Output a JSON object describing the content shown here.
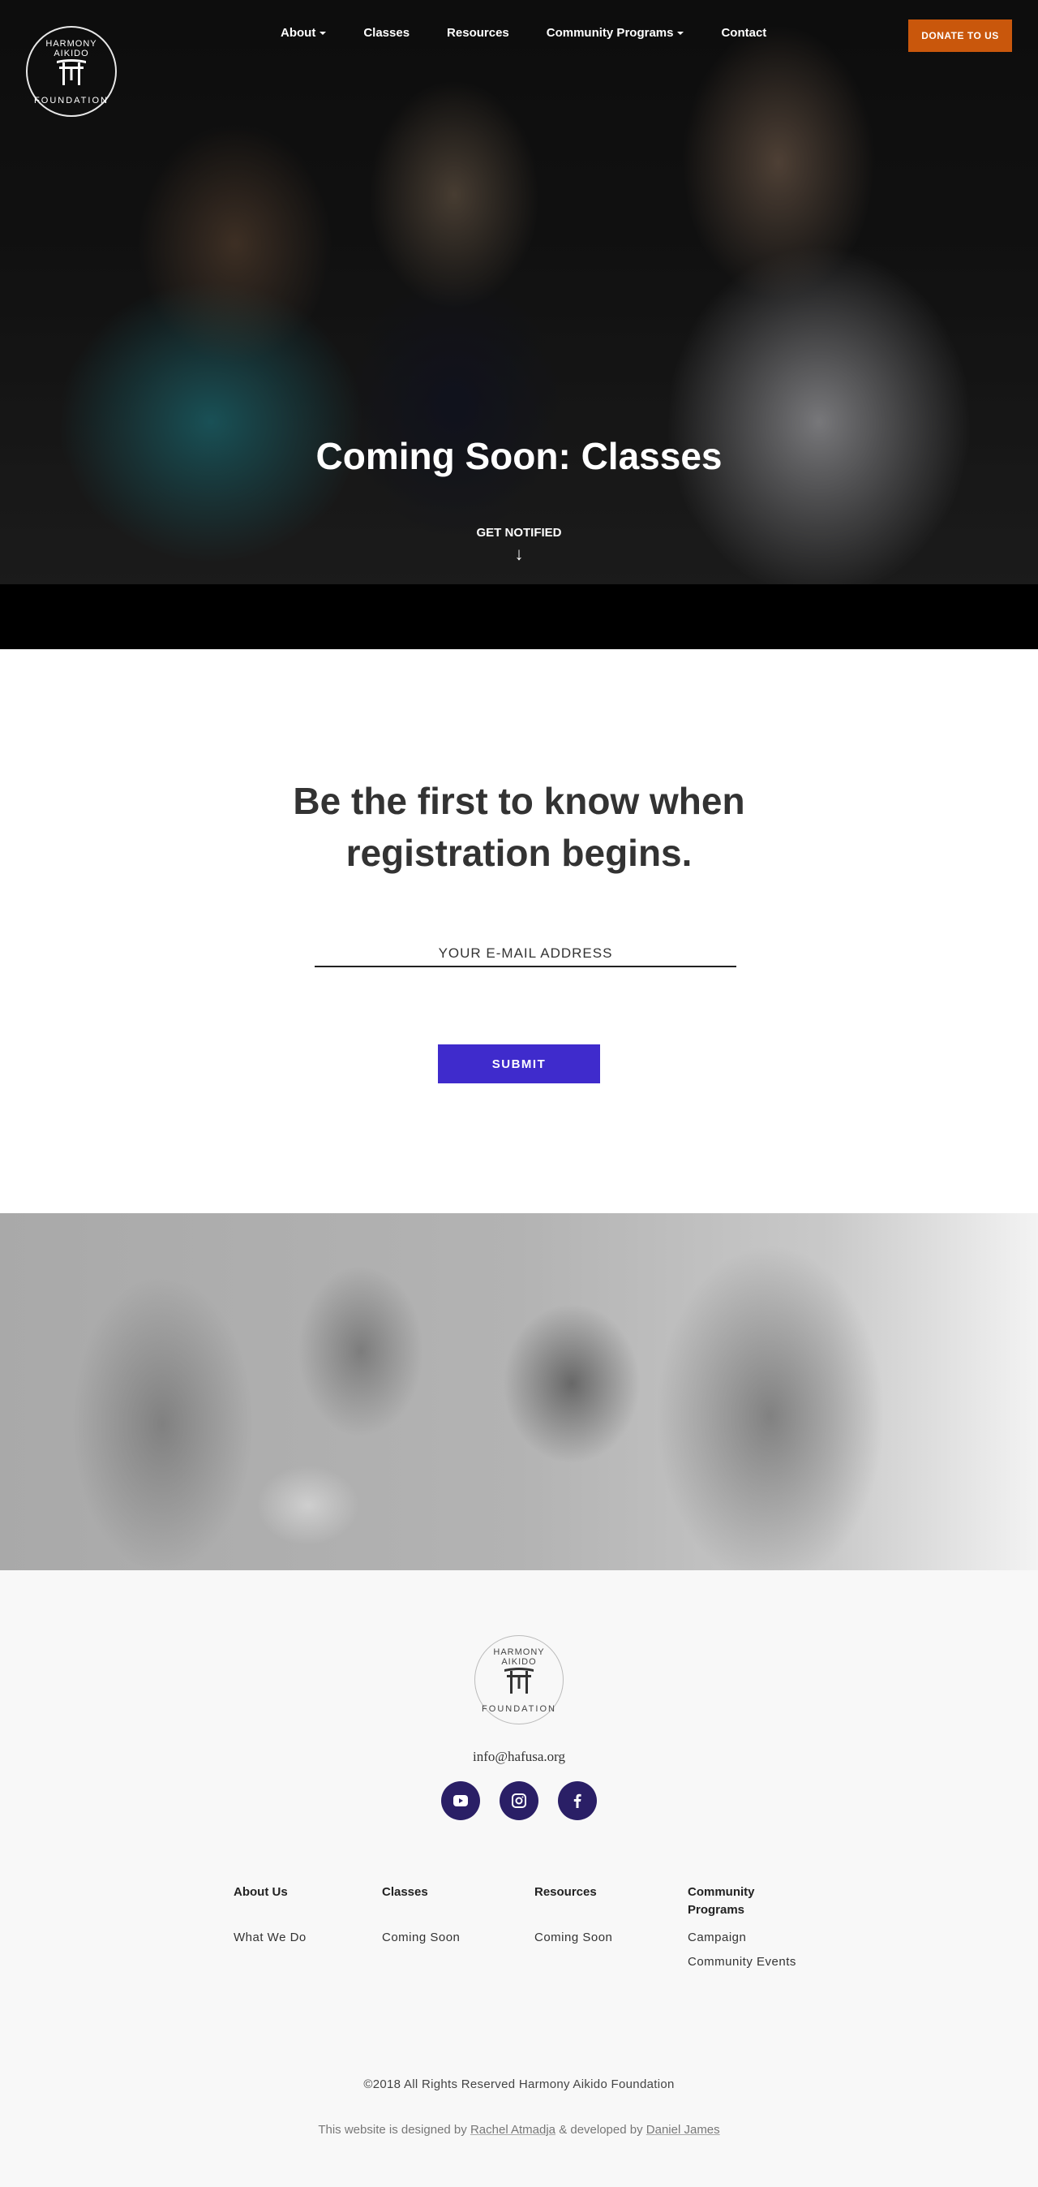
{
  "logo": {
    "top": "HARMONY AIKIDO",
    "bottom": "FOUNDATION"
  },
  "nav": {
    "items": [
      {
        "label": "About",
        "dropdown": true
      },
      {
        "label": "Classes",
        "dropdown": false
      },
      {
        "label": "Resources",
        "dropdown": false
      },
      {
        "label": "Community Programs",
        "dropdown": true
      },
      {
        "label": "Contact",
        "dropdown": false
      }
    ],
    "donate_label": "DONATE TO US"
  },
  "hero": {
    "title": "Coming Soon: Classes",
    "notify_label": "GET NOTIFIED",
    "arrow": "↓"
  },
  "signup": {
    "heading_line1": "Be the first to know when",
    "heading_line2": "registration begins.",
    "email_placeholder": "YOUR E-MAIL ADDRESS",
    "submit_label": "SUBMIT"
  },
  "footer": {
    "email": "info@hafusa.org",
    "social": [
      "youtube-icon",
      "instagram-icon",
      "facebook-icon"
    ],
    "columns": [
      {
        "heading": "About Us",
        "links": [
          "What We Do"
        ]
      },
      {
        "heading": "Classes",
        "links": [
          "Coming Soon"
        ]
      },
      {
        "heading": "Resources",
        "links": [
          "Coming Soon"
        ]
      },
      {
        "heading": "Community Programs",
        "links": [
          "Campaign",
          "Community Events"
        ]
      }
    ],
    "copyright": "©2018  All Rights Reserved  Harmony Aikido Foundation",
    "credits_prefix": "This website is designed by",
    "designer": "Rachel Atmadja",
    "credits_mid": "& developed by",
    "developer": "Daniel James"
  },
  "colors": {
    "donate": "#c9570c",
    "submit": "#3f2bcc",
    "social": "#2a1f66"
  }
}
